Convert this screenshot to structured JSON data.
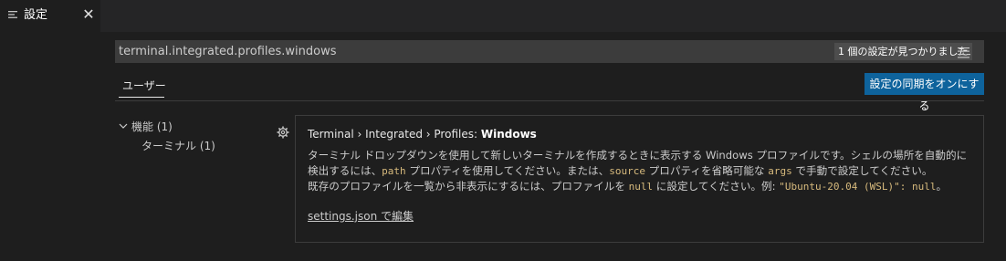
{
  "tab": {
    "icon": "settings-list-icon",
    "label": "設定",
    "close_glyph": "✕"
  },
  "search": {
    "value": "terminal.integrated.profiles.windows",
    "result_count": "1 個の設定が見つかりました",
    "filter_icon": "filter-list-icon"
  },
  "scope": {
    "tab_label": "ユーザー"
  },
  "sync_button": {
    "label": "設定の同期をオンにする"
  },
  "toc": {
    "group_label": "機能 (1)",
    "child_label": "ターミナル (1)"
  },
  "setting": {
    "gear_icon": "gear-icon",
    "title_prefix": "Terminal › Integrated › Profiles: ",
    "title_name": "Windows",
    "desc": {
      "t1": "ターミナル ドロップダウンを使用して新しいターミナルを作成するときに表示する Windows プロファイルです。シェルの場所を自動的に検出するには、",
      "c1": "path",
      "t2": " プロパティを使用してください。または、",
      "c2": "source",
      "t3": " プロパティを省略可能な ",
      "c3": "args",
      "t4": " で手動で設定してください。",
      "t5": "既存のプロファイルを一覧から非表示にするには、プロファイルを ",
      "c4": "null",
      "t6": " に設定してください。例: ",
      "c5": "\"Ubuntu-20.04 (WSL)\": null",
      "t7": "。"
    },
    "edit_link": "settings.json で編集"
  },
  "colors": {
    "background": "#1e1e1e",
    "button": "#0e639c",
    "code": "#d7ba7d"
  }
}
